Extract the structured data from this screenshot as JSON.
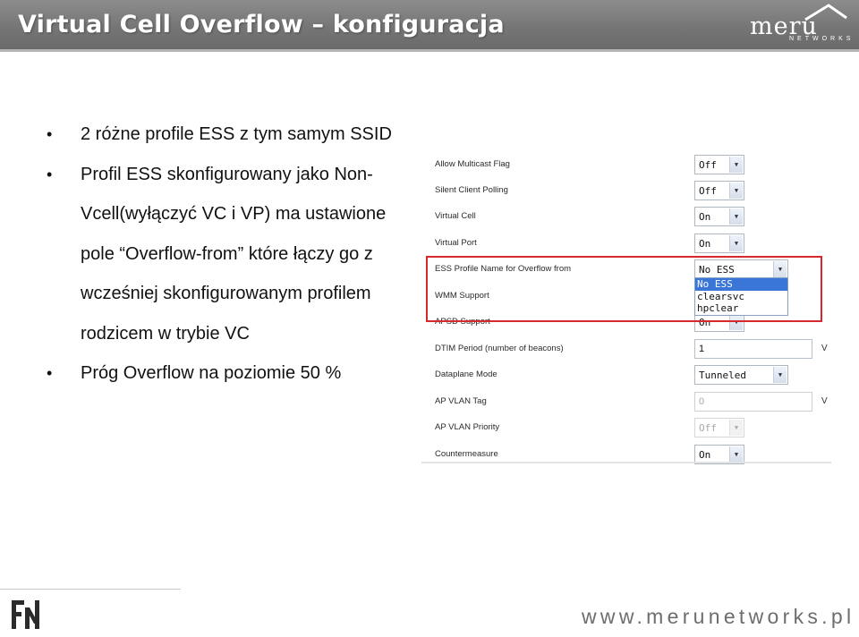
{
  "slide": {
    "title": "Virtual Cell Overflow – konfiguracja",
    "logo": {
      "name": "meru",
      "sub": "NETWORKS"
    },
    "bullets": [
      "2 różne profile ESS z tym samym SSID",
      "Profil ESS skonfigurowany jako Non-",
      "Vcell(wyłączyć VC i VP) ma ustawione",
      "pole  “Overflow-from”  które łączy go z",
      "wcześniej skonfigurowanym profilem",
      "rodzicem w trybie VC",
      "Próg Overflow na poziomie 50 %"
    ],
    "website": "www.merunetworks.pl",
    "footer_logo": "FN"
  },
  "config": {
    "rows": [
      {
        "label": "Allow Multicast Flag",
        "value": "Off"
      },
      {
        "label": "Silent Client Polling",
        "value": "Off"
      },
      {
        "label": "Virtual Cell",
        "value": "On"
      },
      {
        "label": "Virtual Port",
        "value": "On"
      },
      {
        "label": "ESS Profile Name for Overflow from",
        "value": "No ESS"
      },
      {
        "label": "WMM Support",
        "value": ""
      },
      {
        "label": "APSD Support",
        "value": "On"
      },
      {
        "label": "DTIM Period (number of beacons)",
        "value": "1",
        "unit": "V"
      },
      {
        "label": "Dataplane Mode",
        "value": "Tunneled"
      },
      {
        "label": "AP VLAN Tag",
        "value": "0",
        "unit": "V"
      },
      {
        "label": "AP VLAN Priority",
        "value": "Off"
      },
      {
        "label": "Countermeasure",
        "value": "On"
      }
    ],
    "overflow_options": [
      "No ESS",
      "clearsvc",
      "hpclear"
    ],
    "selected_option": "No ESS"
  },
  "colors": {
    "title_bar": "#767676",
    "highlight": "#d7282e",
    "selection": "#3a76d8"
  }
}
